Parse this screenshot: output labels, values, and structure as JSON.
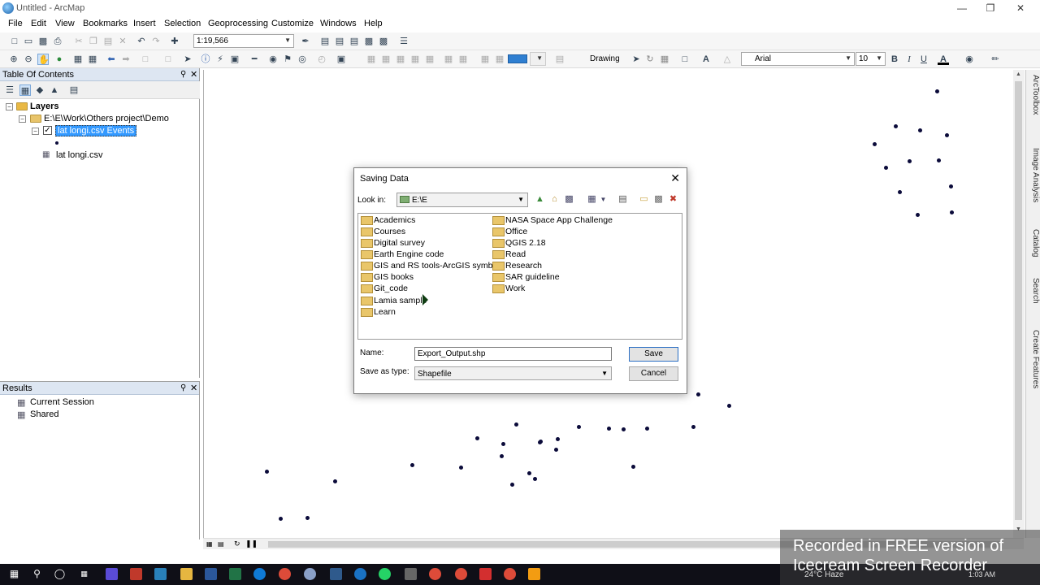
{
  "window": {
    "title": "Untitled - ArcMap"
  },
  "menu": [
    "File",
    "Edit",
    "View",
    "Bookmarks",
    "Insert",
    "Selection",
    "Geoprocessing",
    "Customize",
    "Windows",
    "Help"
  ],
  "toolbar": {
    "scale": "1:19,566",
    "drawing_label": "Drawing",
    "font_name": "Arial",
    "font_size": "10",
    "bold": "B",
    "italic": "I",
    "underline": "U",
    "font_color": "A"
  },
  "toc": {
    "title": "Table Of Contents",
    "root": "Layers",
    "folder": "E:\\E\\Work\\Others project\\Demo",
    "layer": "lat longi.csv Events",
    "table": "lat longi.csv"
  },
  "results": {
    "title": "Results",
    "items": [
      "Current Session",
      "Shared"
    ]
  },
  "right_dock": [
    "ArcToolbox",
    "Image Analysis",
    "Catalog",
    "Search",
    "Create Features"
  ],
  "dialog": {
    "title": "Saving Data",
    "look_in_label": "Look in:",
    "look_in_value": "E:\\E",
    "folders_col1": [
      "Academics",
      "Courses",
      "Digital survey",
      "Earth Engine code",
      "GIS and RS tools-ArcGIS symbol",
      "GIS books",
      "Git_code",
      "Lamia sample",
      "Learn"
    ],
    "folders_col2": [
      "NASA Space App Challenge",
      "Office",
      "QGIS 2.18",
      "Read",
      "Research",
      "SAR guideline",
      "Work"
    ],
    "name_label": "Name:",
    "name_value": "Export_Output.shp",
    "type_label": "Save as type:",
    "type_value": "Shapefile",
    "save_label": "Save",
    "cancel_label": "Cancel"
  },
  "watermark": {
    "line1": "Recorded in FREE version of",
    "line2": "Icecream Screen Recorder"
  },
  "taskbar": {
    "weather": "24°C Haze",
    "time": "1:03 AM"
  }
}
